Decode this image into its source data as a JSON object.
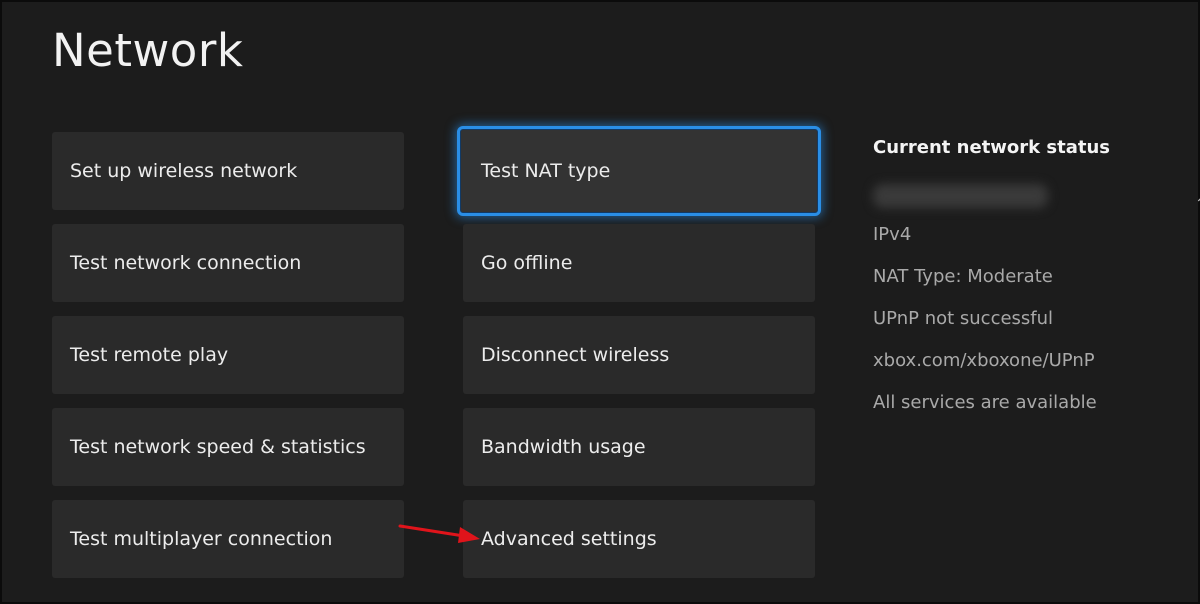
{
  "page": {
    "title": "Network"
  },
  "menu": {
    "left": [
      {
        "label": "Set up wireless network"
      },
      {
        "label": "Test network connection"
      },
      {
        "label": "Test remote play"
      },
      {
        "label": "Test network speed & statistics"
      },
      {
        "label": "Test multiplayer connection"
      }
    ],
    "middle": [
      {
        "label": "Test NAT type",
        "focused": true
      },
      {
        "label": "Go offline"
      },
      {
        "label": "Disconnect wireless"
      },
      {
        "label": "Bandwidth usage"
      },
      {
        "label": "Advanced settings"
      }
    ]
  },
  "status": {
    "heading": "Current network status",
    "lines": [
      "IPv4",
      "NAT Type: Moderate",
      "UPnP not successful",
      "xbox.com/xboxone/UPnP",
      "All services are available"
    ]
  },
  "colors": {
    "focus_outline": "#2a8ee6",
    "annotation_arrow": "#e0141b"
  }
}
